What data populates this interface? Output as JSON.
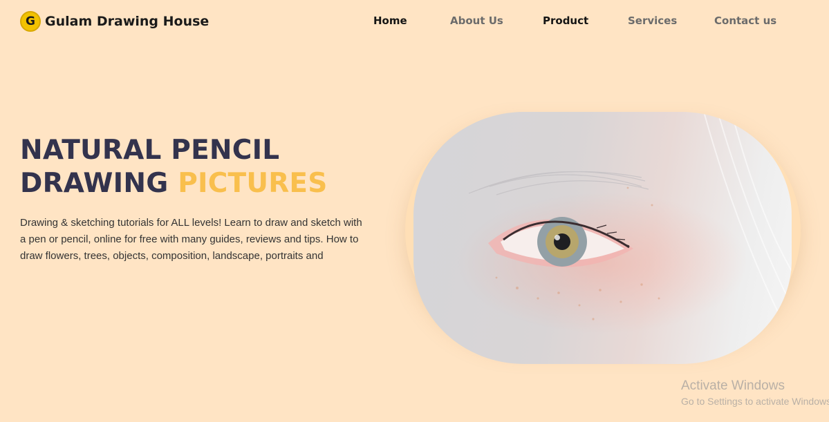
{
  "brand": {
    "logo_letter": "G",
    "name": "Gulam Drawing House"
  },
  "nav": {
    "items": [
      {
        "label": "Home"
      },
      {
        "label": "About Us"
      },
      {
        "label": "Product"
      },
      {
        "label": "Services"
      },
      {
        "label": "Contact us"
      }
    ]
  },
  "hero": {
    "title_line1": "NATURAL PENCIL",
    "title_line2_main": "DRAWING",
    "title_line2_accent": "PICTURES",
    "description": "Drawing & sketching tutorials for ALL levels! Learn to draw and sketch with a pen or pencil, online for free with many guides, reviews and tips. How to draw flowers, trees, objects, composition, landscape, portraits and"
  },
  "watermark": {
    "line1": "Activate Windows",
    "line2": "Go to Settings to activate Windows."
  },
  "colors": {
    "background": "#ffe4c4",
    "heading": "#33334d",
    "accent": "#f9bf4d",
    "logo": "#f2c200"
  }
}
